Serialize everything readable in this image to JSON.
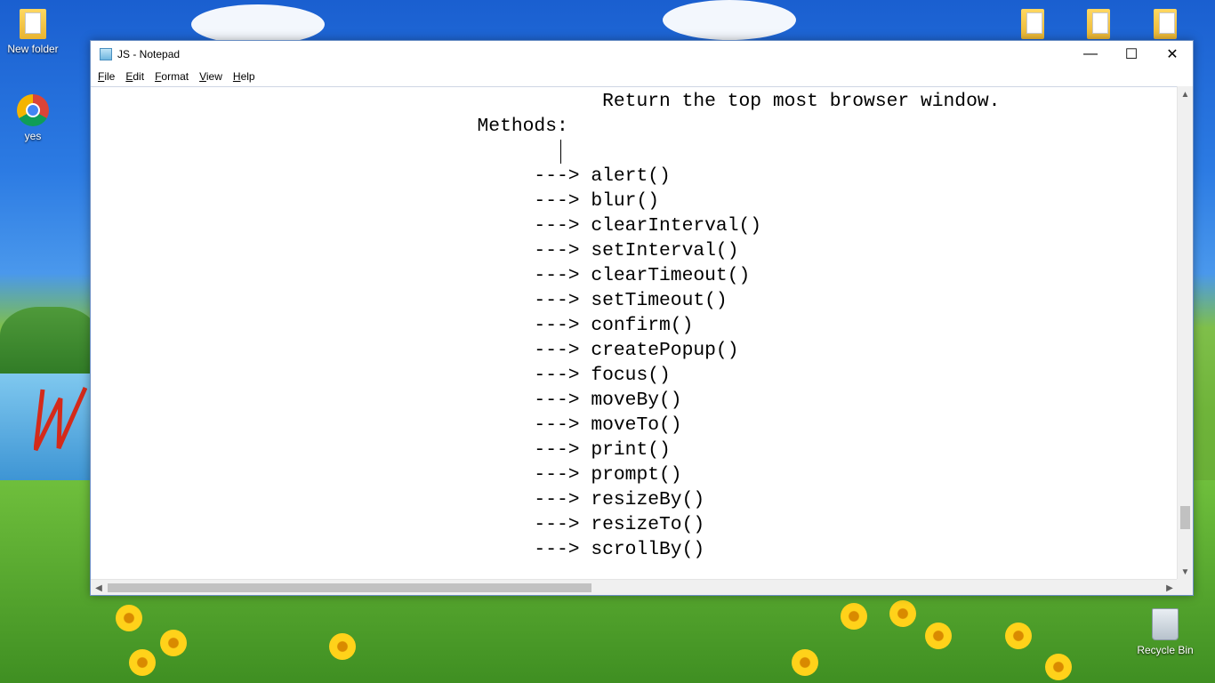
{
  "desktop": {
    "icons": [
      {
        "label": "New folder"
      },
      {
        "label": "yes"
      },
      {
        "label": "Recycle Bin"
      }
    ]
  },
  "window": {
    "title": "JS - Notepad",
    "controls": {
      "minimize": "—",
      "maximize": "☐",
      "close": "✕"
    }
  },
  "menu": {
    "file": {
      "key": "F",
      "rest": "ile"
    },
    "edit": {
      "key": "E",
      "rest": "dit"
    },
    "format": {
      "key": "F",
      "rest": "ormat",
      "prefix": ""
    },
    "view": {
      "key": "V",
      "rest": "iew"
    },
    "help": {
      "key": "H",
      "rest": "elp"
    }
  },
  "document": {
    "lines": [
      "                                             Return the top most browser window.",
      "                                  Methods:",
      "",
      "                                       ---> alert()",
      "                                       ---> blur()",
      "                                       ---> clearInterval()",
      "                                       ---> setInterval()",
      "                                       ---> clearTimeout()",
      "                                       ---> setTimeout()",
      "                                       ---> confirm()",
      "                                       ---> createPopup()",
      "                                       ---> focus()",
      "                                       ---> moveBy()",
      "                                       ---> moveTo()",
      "                                       ---> print()",
      "                                       ---> prompt()",
      "                                       ---> resizeBy()",
      "                                       ---> resizeTo()",
      "                                       ---> scrollBy()"
    ]
  },
  "scrollbars": {
    "up": "▲",
    "down": "▼",
    "left": "◀",
    "right": "▶",
    "vertical_position": 0.92,
    "horizontal_position": 0.0
  }
}
